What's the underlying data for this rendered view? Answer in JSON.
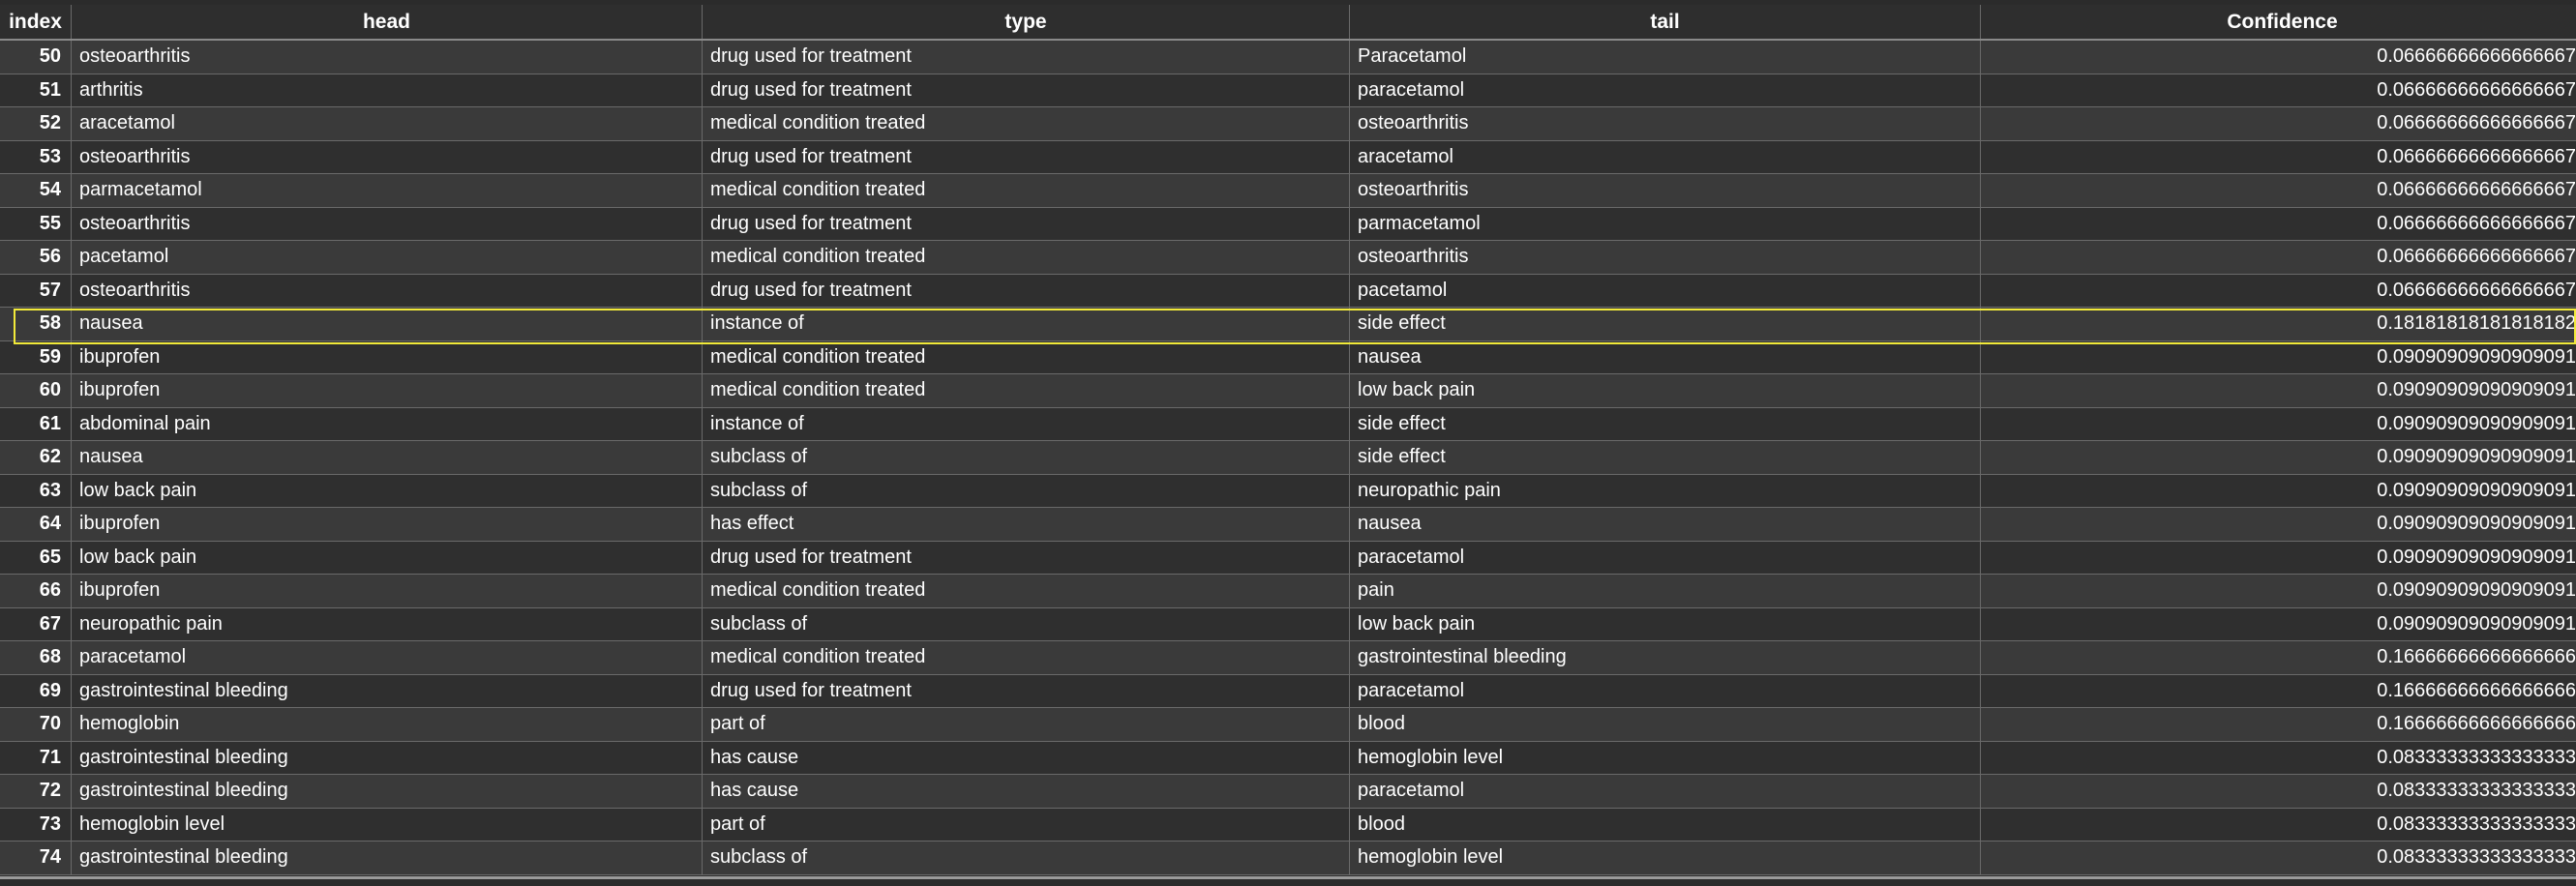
{
  "columns": {
    "index": "index",
    "head": "head",
    "type": "type",
    "tail": "tail",
    "confidence": "Confidence"
  },
  "rows": [
    {
      "index": "50",
      "head": "osteoarthritis",
      "type": "drug used for treatment",
      "tail": "Paracetamol",
      "confidence": "0.06666666666666667"
    },
    {
      "index": "51",
      "head": "arthritis",
      "type": "drug used for treatment",
      "tail": "paracetamol",
      "confidence": "0.06666666666666667"
    },
    {
      "index": "52",
      "head": "aracetamol",
      "type": "medical condition treated",
      "tail": "osteoarthritis",
      "confidence": "0.06666666666666667"
    },
    {
      "index": "53",
      "head": "osteoarthritis",
      "type": "drug used for treatment",
      "tail": "aracetamol",
      "confidence": "0.06666666666666667"
    },
    {
      "index": "54",
      "head": "parmacetamol",
      "type": "medical condition treated",
      "tail": "osteoarthritis",
      "confidence": "0.06666666666666667"
    },
    {
      "index": "55",
      "head": "osteoarthritis",
      "type": "drug used for treatment",
      "tail": "parmacetamol",
      "confidence": "0.06666666666666667"
    },
    {
      "index": "56",
      "head": "pacetamol",
      "type": "medical condition treated",
      "tail": "osteoarthritis",
      "confidence": "0.06666666666666667"
    },
    {
      "index": "57",
      "head": "osteoarthritis",
      "type": "drug used for treatment",
      "tail": "pacetamol",
      "confidence": "0.06666666666666667"
    },
    {
      "index": "58",
      "head": "nausea",
      "type": "instance of",
      "tail": "side effect",
      "confidence": "0.18181818181818182"
    },
    {
      "index": "59",
      "head": "ibuprofen",
      "type": "medical condition treated",
      "tail": "nausea",
      "confidence": "0.09090909090909091"
    },
    {
      "index": "60",
      "head": "ibuprofen",
      "type": "medical condition treated",
      "tail": "low back pain",
      "confidence": "0.09090909090909091"
    },
    {
      "index": "61",
      "head": "abdominal pain",
      "type": "instance of",
      "tail": "side effect",
      "confidence": "0.09090909090909091"
    },
    {
      "index": "62",
      "head": "nausea",
      "type": "subclass of",
      "tail": "side effect",
      "confidence": "0.09090909090909091"
    },
    {
      "index": "63",
      "head": "low back pain",
      "type": "subclass of",
      "tail": "neuropathic pain",
      "confidence": "0.09090909090909091"
    },
    {
      "index": "64",
      "head": "ibuprofen",
      "type": "has effect",
      "tail": "nausea",
      "confidence": "0.09090909090909091"
    },
    {
      "index": "65",
      "head": "low back pain",
      "type": "drug used for treatment",
      "tail": "paracetamol",
      "confidence": "0.09090909090909091"
    },
    {
      "index": "66",
      "head": "ibuprofen",
      "type": "medical condition treated",
      "tail": "pain",
      "confidence": "0.09090909090909091"
    },
    {
      "index": "67",
      "head": "neuropathic pain",
      "type": "subclass of",
      "tail": "low back pain",
      "confidence": "0.09090909090909091"
    },
    {
      "index": "68",
      "head": "paracetamol",
      "type": "medical condition treated",
      "tail": "gastrointestinal bleeding",
      "confidence": "0.16666666666666666"
    },
    {
      "index": "69",
      "head": "gastrointestinal bleeding",
      "type": "drug used for treatment",
      "tail": "paracetamol",
      "confidence": "0.16666666666666666"
    },
    {
      "index": "70",
      "head": "hemoglobin",
      "type": "part of",
      "tail": "blood",
      "confidence": "0.16666666666666666"
    },
    {
      "index": "71",
      "head": "gastrointestinal bleeding",
      "type": "has cause",
      "tail": "hemoglobin level",
      "confidence": "0.08333333333333333"
    },
    {
      "index": "72",
      "head": "gastrointestinal bleeding",
      "type": "has cause",
      "tail": "paracetamol",
      "confidence": "0.08333333333333333"
    },
    {
      "index": "73",
      "head": "hemoglobin level",
      "type": "part of",
      "tail": "blood",
      "confidence": "0.08333333333333333"
    },
    {
      "index": "74",
      "head": "gastrointestinal bleeding",
      "type": "subclass of",
      "tail": "hemoglobin level",
      "confidence": "0.08333333333333333"
    }
  ],
  "selected_index": "58",
  "colors": {
    "background": "#2b2b2b",
    "row_even": "#3a3a3a",
    "row_odd": "#2f2f2f",
    "grid_line": "#6a6a6a",
    "selection_outline": "#f2ea3a",
    "text": "#ffffff"
  }
}
